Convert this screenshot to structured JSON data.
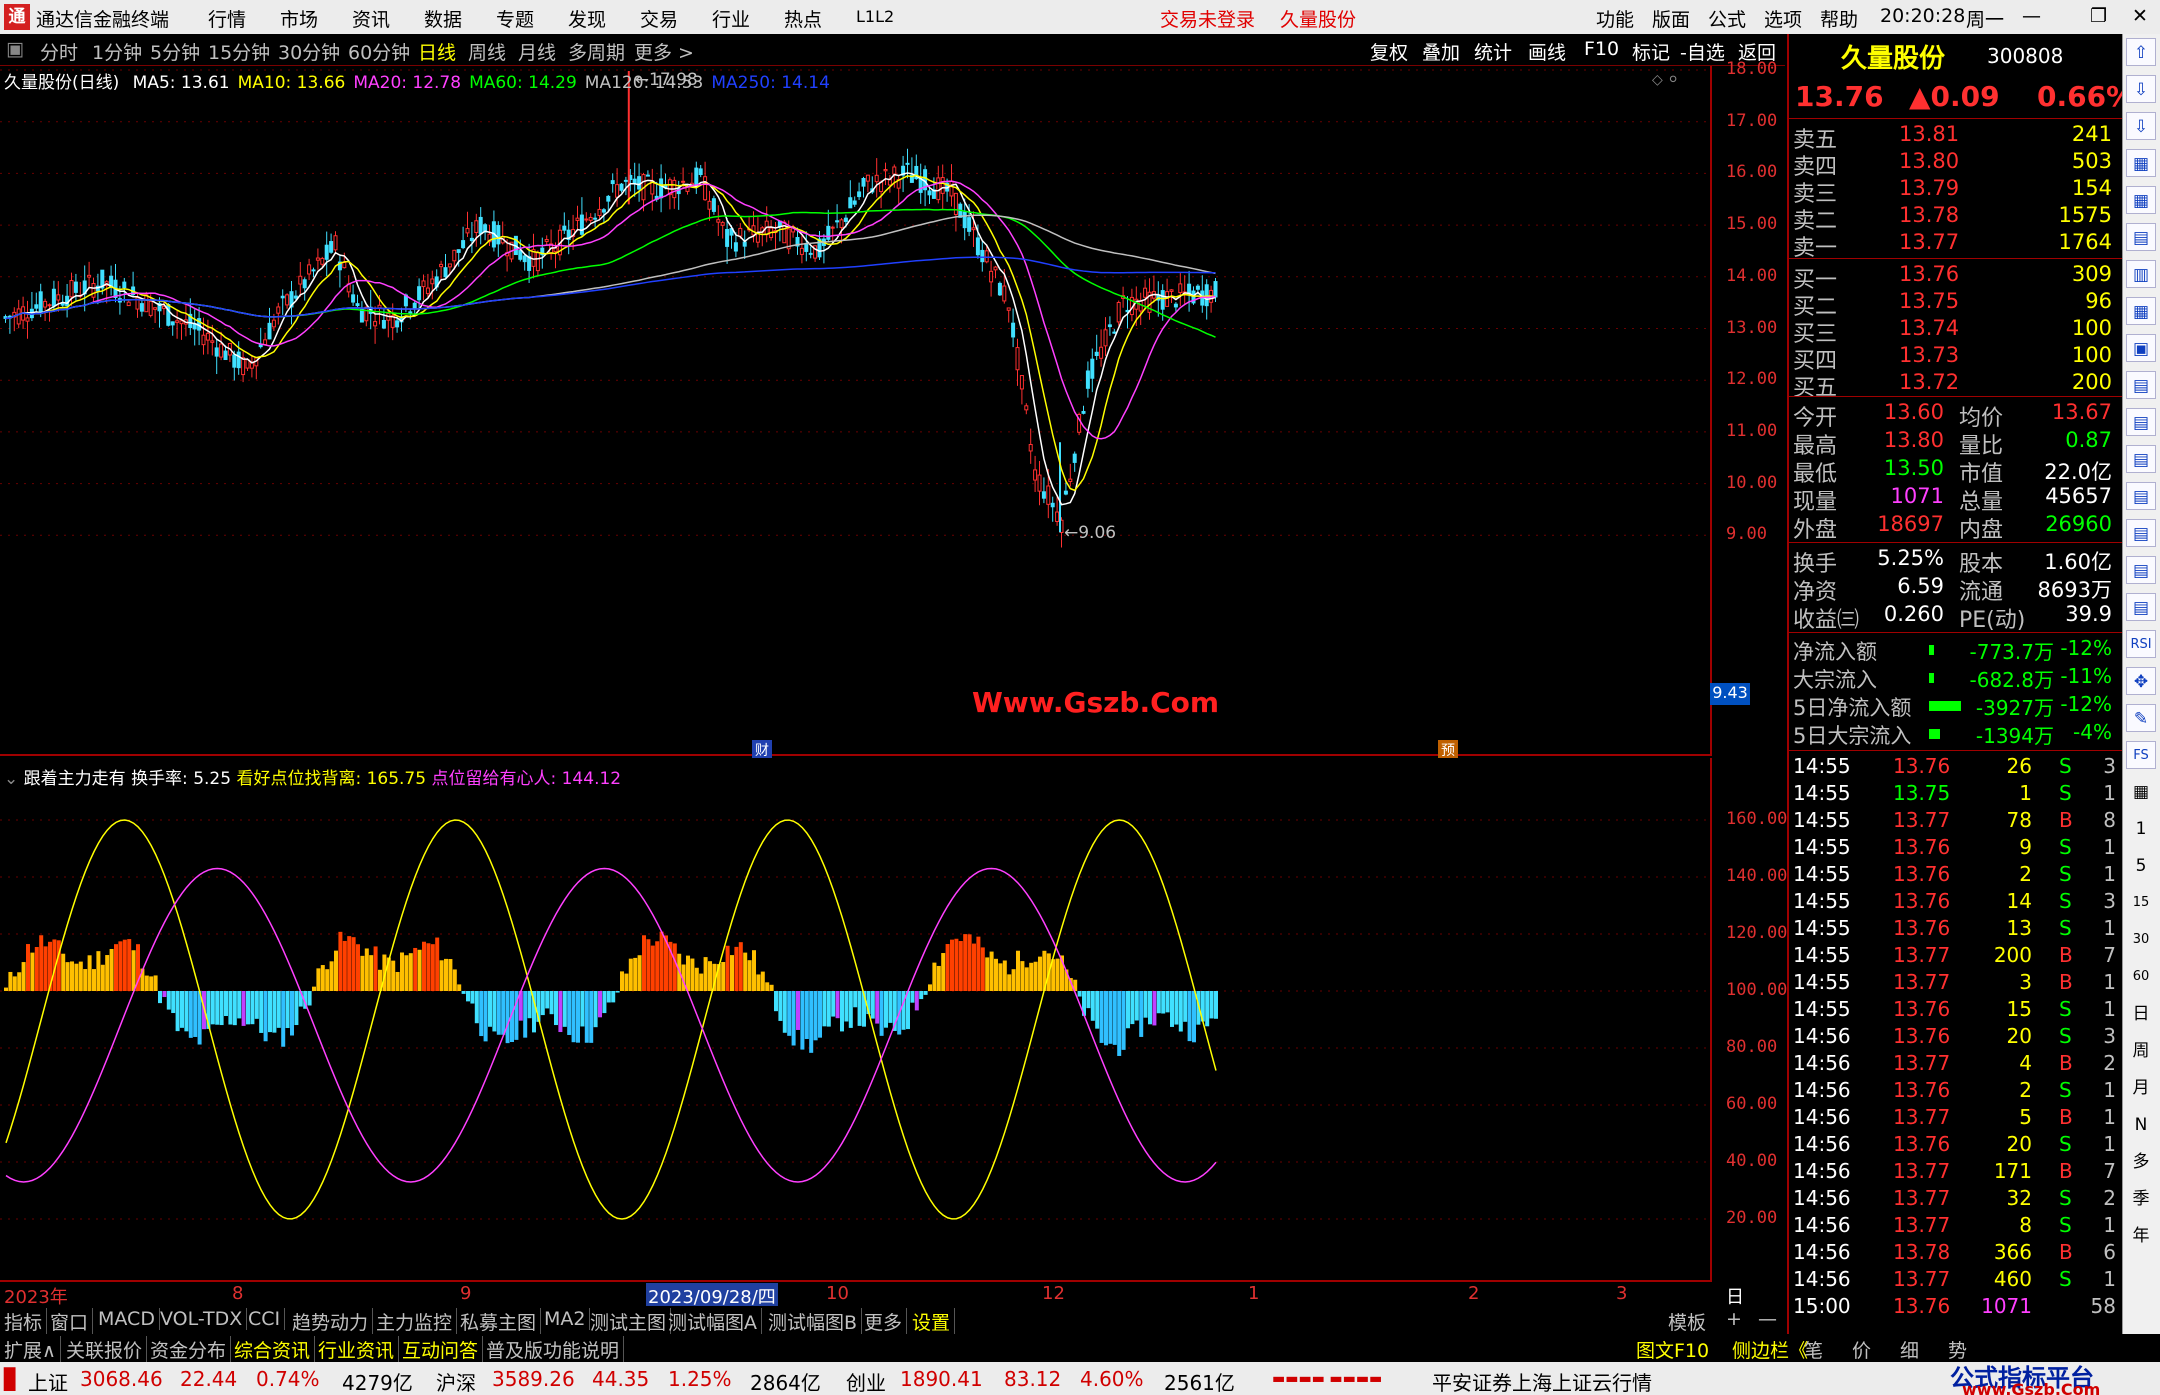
{
  "app": {
    "title": "通达信金融终端",
    "menu": [
      "行情",
      "市场",
      "资讯",
      "数据",
      "专题",
      "发现",
      "交易",
      "行业",
      "热点",
      "L1L2"
    ],
    "trade_status": "交易未登录",
    "stock_title": "久量股份",
    "right_menu": [
      "功能",
      "版面",
      "公式",
      "选项",
      "帮助"
    ],
    "clock": "20:20:28",
    "weekday": "周一",
    "window_controls": [
      "—",
      "❐",
      "✕"
    ]
  },
  "periods": {
    "items": [
      "分时",
      "1分钟",
      "5分钟",
      "15分钟",
      "30分钟",
      "60分钟",
      "日线",
      "周线",
      "月线",
      "多周期",
      "更多 >"
    ],
    "active": "日线",
    "right_buttons": [
      "复权",
      "叠加",
      "统计",
      "画线",
      "F10",
      "标记",
      "-自选",
      "返回"
    ]
  },
  "main_chart": {
    "name_label": "久量股份(日线)",
    "ma": [
      {
        "label": "MA5: 13.61",
        "color": "#ffffff"
      },
      {
        "label": "MA10: 13.66",
        "color": "#ffff00"
      },
      {
        "label": "MA20: 12.78",
        "color": "#ff40ff"
      },
      {
        "label": "MA60: 14.29",
        "color": "#00ff00"
      },
      {
        "label": "MA120: 14.53",
        "color": "#c0c0c0"
      },
      {
        "label": "MA250: 14.14",
        "color": "#2040ff"
      }
    ],
    "y_ticks": [
      "18.00",
      "17.00",
      "16.00",
      "15.00",
      "14.00",
      "13.00",
      "12.00",
      "11.00",
      "10.00",
      "9.00"
    ],
    "price_tag": "9.43",
    "high_mark": "17.98",
    "low_mark": "9.06",
    "watermark": "Www.Gszb.Com",
    "event_markers": [
      "财",
      "预"
    ]
  },
  "indicator": {
    "name": "跟着主力走有",
    "params": [
      {
        "label": "换手率: 5.25",
        "color": "#ffffff"
      },
      {
        "label": "看好点位找背离: 165.75",
        "color": "#ffff00"
      },
      {
        "label": "点位留给有心人: 144.12",
        "color": "#ff40ff"
      }
    ],
    "y_ticks": [
      "160.00",
      "140.00",
      "120.00",
      "100.00",
      "80.00",
      "60.00",
      "40.00",
      "20.00"
    ]
  },
  "date_axis": {
    "labels": [
      "2023年",
      "8",
      "9",
      "2023/09/28/四",
      "10",
      "12",
      "1",
      "2",
      "3"
    ],
    "period_label": "日线"
  },
  "tabs": {
    "row1": [
      "指标",
      "窗口",
      "MACD",
      "VOL-TDX",
      "CCI",
      "趋势动力",
      "主力监控",
      "私募主图",
      "MA2",
      "测试主图",
      "测试幅图A",
      "测试幅图B",
      "更多",
      "设置"
    ],
    "row1_right": [
      "模板",
      "+",
      "—"
    ],
    "row2": [
      "扩展∧",
      "关联报价",
      "资金分布",
      "综合资讯",
      "行业资讯",
      "互动问答",
      "普及版功能说明"
    ],
    "row2_right": [
      "图文F10",
      "侧边栏《",
      "笔",
      "价",
      "细",
      "势"
    ]
  },
  "quote": {
    "name": "久量股份",
    "code": "300808",
    "price": "13.76",
    "change": "▲0.09",
    "pct": "0.66%",
    "asks": [
      {
        "label": "卖五",
        "price": "13.81",
        "vol": "241"
      },
      {
        "label": "卖四",
        "price": "13.80",
        "vol": "503"
      },
      {
        "label": "卖三",
        "price": "13.79",
        "vol": "154"
      },
      {
        "label": "卖二",
        "price": "13.78",
        "vol": "1575"
      },
      {
        "label": "卖一",
        "price": "13.77",
        "vol": "1764"
      }
    ],
    "bids": [
      {
        "label": "买一",
        "price": "13.76",
        "vol": "309"
      },
      {
        "label": "买二",
        "price": "13.75",
        "vol": "96"
      },
      {
        "label": "买三",
        "price": "13.74",
        "vol": "100"
      },
      {
        "label": "买四",
        "price": "13.73",
        "vol": "100"
      },
      {
        "label": "买五",
        "price": "13.72",
        "vol": "200"
      }
    ],
    "stats": [
      {
        "l1": "今开",
        "v1": "13.60",
        "c1": "red",
        "l2": "均价",
        "v2": "13.67",
        "c2": "red"
      },
      {
        "l1": "最高",
        "v1": "13.80",
        "c1": "red",
        "l2": "量比",
        "v2": "0.87",
        "c2": "grn"
      },
      {
        "l1": "最低",
        "v1": "13.50",
        "c1": "grn",
        "l2": "市值",
        "v2": "22.0亿",
        "c2": "wht"
      },
      {
        "l1": "现量",
        "v1": "1071",
        "c1": "mag",
        "l2": "总量",
        "v2": "45657",
        "c2": "wht"
      },
      {
        "l1": "外盘",
        "v1": "18697",
        "c1": "red",
        "l2": "内盘",
        "v2": "26960",
        "c2": "grn"
      }
    ],
    "stats2": [
      {
        "l1": "换手",
        "v1": "5.25%",
        "l2": "股本",
        "v2": "1.60亿"
      },
      {
        "l1": "净资",
        "v1": "6.59",
        "l2": "流通",
        "v2": "8693万"
      },
      {
        "l1": "收益㈢",
        "v1": "0.260",
        "l2": "PE(动)",
        "v2": "39.9"
      }
    ],
    "flows": [
      {
        "label": "净流入额",
        "val": "-773.7万",
        "pct": "-12%",
        "bar": 0.05
      },
      {
        "label": "大宗流入",
        "val": "-682.8万",
        "pct": "-11%",
        "bar": 0.05
      },
      {
        "label": "5日净流入额",
        "val": "-3927万",
        "pct": "-12%",
        "bar": 0.9
      },
      {
        "label": "5日大宗流入",
        "val": "-1394万",
        "pct": "-4%",
        "bar": 0.3
      }
    ],
    "ticks": [
      {
        "t": "14:55",
        "p": "13.76",
        "v": "26",
        "s": "S",
        "n": "3"
      },
      {
        "t": "14:55",
        "p": "13.75",
        "v": "1",
        "s": "S",
        "n": "1"
      },
      {
        "t": "14:55",
        "p": "13.77",
        "v": "78",
        "s": "B",
        "n": "8"
      },
      {
        "t": "14:55",
        "p": "13.76",
        "v": "9",
        "s": "S",
        "n": "1"
      },
      {
        "t": "14:55",
        "p": "13.76",
        "v": "2",
        "s": "S",
        "n": "1"
      },
      {
        "t": "14:55",
        "p": "13.76",
        "v": "14",
        "s": "S",
        "n": "3"
      },
      {
        "t": "14:55",
        "p": "13.76",
        "v": "13",
        "s": "S",
        "n": "1"
      },
      {
        "t": "14:55",
        "p": "13.77",
        "v": "200",
        "s": "B",
        "n": "7"
      },
      {
        "t": "14:55",
        "p": "13.77",
        "v": "3",
        "s": "B",
        "n": "1"
      },
      {
        "t": "14:55",
        "p": "13.76",
        "v": "15",
        "s": "S",
        "n": "1"
      },
      {
        "t": "14:56",
        "p": "13.76",
        "v": "20",
        "s": "S",
        "n": "3"
      },
      {
        "t": "14:56",
        "p": "13.77",
        "v": "4",
        "s": "B",
        "n": "2"
      },
      {
        "t": "14:56",
        "p": "13.76",
        "v": "2",
        "s": "S",
        "n": "1"
      },
      {
        "t": "14:56",
        "p": "13.77",
        "v": "5",
        "s": "B",
        "n": "1"
      },
      {
        "t": "14:56",
        "p": "13.76",
        "v": "20",
        "s": "S",
        "n": "1"
      },
      {
        "t": "14:56",
        "p": "13.77",
        "v": "171",
        "s": "B",
        "n": "7"
      },
      {
        "t": "14:56",
        "p": "13.77",
        "v": "32",
        "s": "S",
        "n": "2"
      },
      {
        "t": "14:56",
        "p": "13.77",
        "v": "8",
        "s": "S",
        "n": "1"
      },
      {
        "t": "14:56",
        "p": "13.78",
        "v": "366",
        "s": "B",
        "n": "6"
      },
      {
        "t": "14:56",
        "p": "13.77",
        "v": "460",
        "s": "S",
        "n": "1"
      },
      {
        "t": "15:00",
        "p": "13.76",
        "v": "1071",
        "s": "",
        "n": "58"
      }
    ]
  },
  "side_icons": [
    "⇧",
    "⇩",
    "⇩",
    "▦",
    "▦",
    "▤",
    "▥",
    "▦",
    "▣",
    "▤",
    "▤",
    "▤",
    "▤",
    "▤",
    "▤",
    "▤",
    "RSI",
    "✥",
    "✎",
    "FS",
    "▦",
    "1",
    "5",
    "15",
    "30",
    "60",
    "日",
    "周",
    "月",
    "N",
    "多",
    "季",
    "年"
  ],
  "status": {
    "indices": [
      {
        "name": "上证",
        "val": "3068.46",
        "chg": "22.44",
        "pct": "0.74%",
        "amt": "4279亿"
      },
      {
        "name": "沪深",
        "val": "3589.26",
        "chg": "44.35",
        "pct": "1.25%",
        "amt": "2864亿"
      },
      {
        "name": "创业",
        "val": "1890.41",
        "chg": "83.12",
        "pct": "4.60%",
        "amt": "2561亿"
      }
    ],
    "broker": "平安证券上海上证云行情",
    "watermark2": "公式指标平台",
    "watermark3": "www.Gszb.Com"
  }
}
